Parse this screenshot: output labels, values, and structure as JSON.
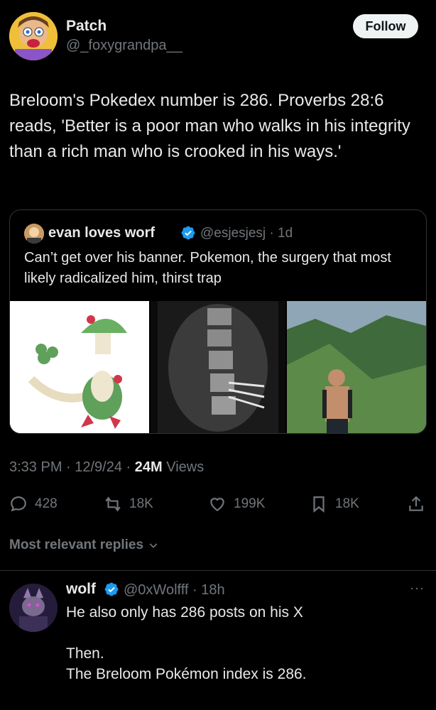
{
  "colors": {
    "background": "#000000",
    "text": "#e7e9ea",
    "muted": "#71767b",
    "verified": "#1d9bf0",
    "divider": "#2f3336"
  },
  "author": {
    "name": "Patch",
    "handle": "@_foxygrandpa__",
    "follow_label": "Follow"
  },
  "tweet": {
    "text": "Breloom's Pokedex number is 286. Proverbs 28:6 reads, 'Better is a poor man who walks in his integrity than a rich man who is crooked in his ways.'"
  },
  "quote": {
    "name": "evan loves worf",
    "handle": "@esjesjesj · 1d",
    "text": "Can’t get over his banner. Pokemon, the surgery that most likely radicalized him, thirst trap",
    "images": [
      "breloom-pokemon",
      "spine-xray",
      "man-on-mountain"
    ]
  },
  "meta": {
    "time_date": "3:33 PM · 12/9/24 · ",
    "views_count": "24M",
    "views_label": " Views"
  },
  "actions": {
    "replies": "428",
    "reposts": "18K",
    "likes": "199K",
    "bookmarks": "18K"
  },
  "sort": {
    "label": "Most relevant replies"
  },
  "reply": {
    "name": "wolf",
    "handle": "@0xWolfff · 18h",
    "more": "···",
    "lines": [
      "He also only has 286 posts on his X",
      "",
      "Then.",
      "The Breloom Pokémon index is 286."
    ]
  }
}
